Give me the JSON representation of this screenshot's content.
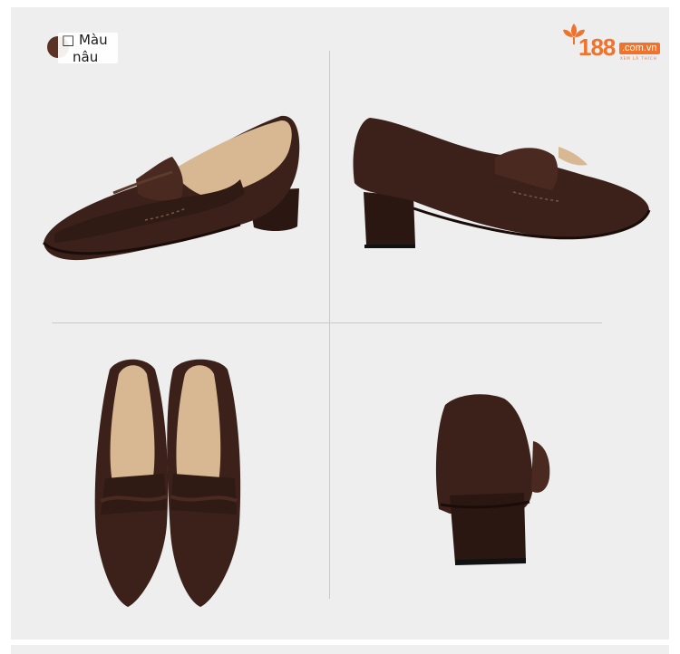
{
  "color_option": {
    "label_line1": "□ Màu",
    "label_line2": "nâu",
    "swatch_color": "#5a3324"
  },
  "logo": {
    "main": "188",
    "domain": ".com.vn",
    "tagline": "XEM LÀ THÍCH",
    "color": "#f0722b"
  },
  "product": {
    "leather_color": "#3b211a",
    "lining_color": "#d8b892"
  }
}
